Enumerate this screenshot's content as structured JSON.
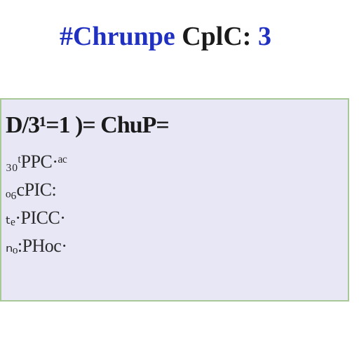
{
  "header": {
    "hash": "#",
    "title_main": "Chrunpe",
    "title_sub": " CplC",
    "colon": ": ",
    "num": "3"
  },
  "panel": {
    "equation": "D/3¹=1 )= ChuP=",
    "rows": [
      "₃₀ᵗPPC·ᵃᶜ",
      "ₒ₆cPIC:",
      "ₜₑ·PICC·",
      "ₙₒ:PHoc·"
    ]
  }
}
